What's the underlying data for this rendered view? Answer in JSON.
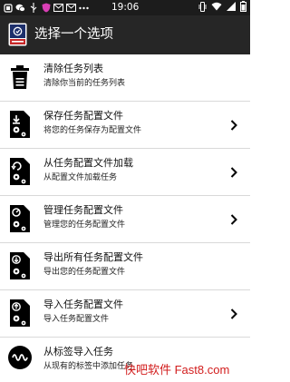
{
  "status_bar": {
    "time": "19:06",
    "left_icons": [
      "app-icon",
      "wechat-icon",
      "usb-icon",
      "shield-icon",
      "mail-icon",
      "mail-icon",
      "ellipsis-icon"
    ],
    "right_icons": [
      "vibrate-icon",
      "wifi-icon",
      "signal-icon",
      "battery-icon"
    ]
  },
  "app_bar": {
    "title": "选择一个选项"
  },
  "menu": {
    "items": [
      {
        "title": "清除任务列表",
        "subtitle": "清除你当前的任务列表",
        "icon": "trash-icon",
        "has_chevron": false
      },
      {
        "title": "保存任务配置文件",
        "subtitle": "将您的任务保存为配置文件",
        "icon": "save-profile-icon",
        "has_chevron": true
      },
      {
        "title": "从任务配置文件加载",
        "subtitle": "从配置文件加载任务",
        "icon": "load-profile-icon",
        "has_chevron": true
      },
      {
        "title": "管理任务配置文件",
        "subtitle": "管理您的任务配置文件",
        "icon": "manage-profile-icon",
        "has_chevron": true
      },
      {
        "title": "导出所有任务配置文件",
        "subtitle": "导出您的任务配置文件",
        "icon": "export-profile-icon",
        "has_chevron": false
      },
      {
        "title": "导入任务配置文件",
        "subtitle": "导入任务配置文件",
        "icon": "import-profile-icon",
        "has_chevron": true
      },
      {
        "title": "从标签导入任务",
        "subtitle": "从现有的标签中添加任务",
        "icon": "nfc-tag-icon",
        "has_chevron": false
      }
    ]
  },
  "watermark": "快吧软件 Fast8.com"
}
